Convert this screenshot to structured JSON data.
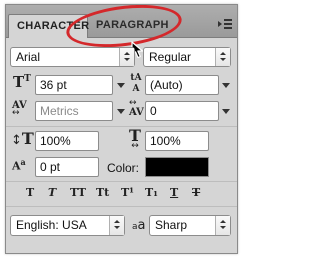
{
  "tabs": {
    "character": "CHARACTER",
    "paragraph": "PARAGRAPH"
  },
  "font": {
    "family": "Arial",
    "style": "Regular"
  },
  "size": {
    "font_size": "36 pt",
    "leading": "(Auto)"
  },
  "spacing": {
    "kerning": "Metrics",
    "tracking": "0"
  },
  "scale": {
    "vertical": "100%",
    "horizontal": "100%"
  },
  "baseline": {
    "shift": "0 pt"
  },
  "color": {
    "label": "Color:",
    "value": "#000000"
  },
  "font_style_buttons": [
    {
      "name": "faux-bold",
      "glyph": "T"
    },
    {
      "name": "faux-italic",
      "glyph": "T"
    },
    {
      "name": "all-caps",
      "glyph": "TT"
    },
    {
      "name": "small-caps",
      "glyph": "Tt"
    },
    {
      "name": "superscript",
      "glyph": "T¹"
    },
    {
      "name": "subscript",
      "glyph": "T₁"
    },
    {
      "name": "underline",
      "glyph": "T"
    },
    {
      "name": "strikethrough",
      "glyph": "T"
    }
  ],
  "language": {
    "value": "English: USA"
  },
  "antialias": {
    "icon_text": "a",
    "value": "Sharp"
  },
  "accent_colors": {
    "highlight_oval": "#d4282b"
  }
}
